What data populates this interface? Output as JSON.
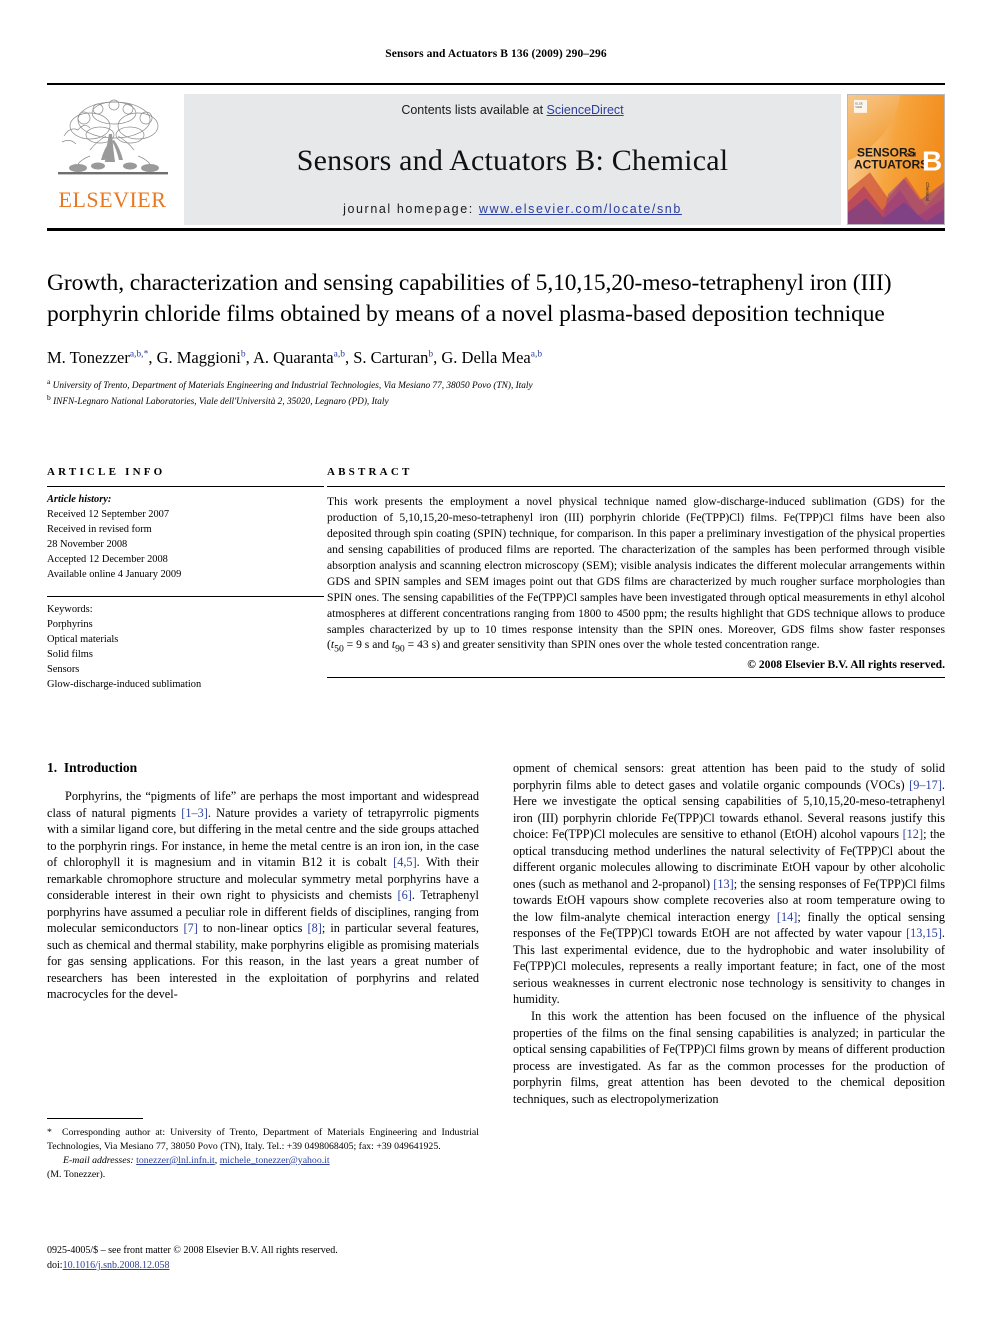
{
  "running_head": "Sensors and Actuators B 136 (2009) 290–296",
  "masthead": {
    "publisher_logo_text": "ELSEVIER",
    "contents_prefix": "Contents lists available at ",
    "contents_link": "ScienceDirect",
    "journal_title": "Sensors and Actuators B: Chemical",
    "homepage_prefix": "journal homepage: ",
    "homepage_url": "www.elsevier.com/locate/snb",
    "cover": {
      "line1": "SENSORS",
      "line1_small": "and",
      "line2": "ACTUATORS",
      "letter": "B",
      "sub": "Chemical"
    },
    "link_color": "#2b3f9e",
    "brand_color": "#E87722",
    "band_color": "#e7e8ea"
  },
  "title": "Growth, characterization and sensing capabilities of 5,10,15,20-meso-tetraphenyl iron (III) porphyrin chloride films obtained by means of a novel plasma-based deposition technique",
  "authors_html": "M. Tonezzer<sup>a,b,</sup><sup>*</sup>, G. Maggioni<sup>b</sup>, A. Quaranta<sup>a,b</sup>, S. Carturan<sup>b</sup>, G. Della Mea<sup>a,b</sup>",
  "affiliations": [
    "University of Trento, Department of Materials Engineering and Industrial Technologies, Via Mesiano 77, 38050 Povo (TN), Italy",
    "INFN-Legnaro National Laboratories, Viale dell'Università 2, 35020, Legnaro (PD), Italy"
  ],
  "affil_markers": [
    "a",
    "b"
  ],
  "article_info": {
    "heading": "ARTICLE INFO",
    "history_label": "Article history:",
    "history": [
      "Received 12 September 2007",
      "Received in revised form",
      "28 November 2008",
      "Accepted 12 December 2008",
      "Available online 4 January 2009"
    ],
    "keywords_label": "Keywords:",
    "keywords": [
      "Porphyrins",
      "Optical materials",
      "Solid films",
      "Sensors",
      "Glow-discharge-induced sublimation"
    ]
  },
  "abstract": {
    "heading": "ABSTRACT",
    "text": "This work presents the employment a novel physical technique named glow-discharge-induced sublimation (GDS) for the production of 5,10,15,20-meso-tetraphenyl iron (III) porphyrin chloride (Fe(TPP)Cl) films. Fe(TPP)Cl films have been also deposited through spin coating (SPIN) technique, for comparison. In this paper a preliminary investigation of the physical properties and sensing capabilities of produced films are reported. The characterization of the samples has been performed through visible absorption analysis and scanning electron microscopy (SEM); visible analysis indicates the different molecular arrangements within GDS and SPIN samples and SEM images point out that GDS films are characterized by much rougher surface morphologies than SPIN ones. The sensing capabilities of the Fe(TPP)Cl samples have been investigated through optical measurements in ethyl alcohol atmospheres at different concentrations ranging from 1800 to 4500 ppm; the results highlight that GDS technique allows to produce samples characterized by up to 10 times response intensity than the SPIN ones. Moreover, GDS films show faster responses (t50 = 9 s and t90 = 43 s) and greater sensitivity than SPIN ones over the whole tested concentration range.",
    "copyright": "© 2008 Elsevier B.V. All rights reserved."
  },
  "introduction": {
    "number": "1.",
    "heading": "Introduction",
    "left_paragraph_html": "Porphyrins, the “pigments of life” are perhaps the most important and widespread class of natural pigments <span class=\"ref\">[1–3]</span>. Nature provides a variety of tetrapyrrolic pigments with a similar ligand core, but differing in the metal centre and the side groups attached to the porphyrin rings. For instance, in heme the metal centre is an iron ion, in the case of chlorophyll it is magnesium and in vitamin B12 it is cobalt <span class=\"ref\">[4,5]</span>. With their remarkable chromophore structure and molecular symmetry metal porphyrins have a considerable interest in their own right to physicists and chemists <span class=\"ref\">[6]</span>. Tetraphenyl porphyrins have assumed a peculiar role in different fields of disciplines, ranging from molecular semiconductors <span class=\"ref\">[7]</span> to non-linear optics <span class=\"ref\">[8]</span>; in particular several features, such as chemical and thermal stability, make porphyrins eligible as promising materials for gas sensing applications. For this reason, in the last years a great number of researchers has been interested in the exploitation of porphyrins and related macrocycles for the devel-",
    "right_paragraph_1_html": "opment of chemical sensors: great attention has been paid to the study of solid porphyrin films able to detect gases and volatile organic compounds (VOCs) <span class=\"ref\">[9–17]</span>. Here we investigate the optical sensing capabilities of 5,10,15,20-meso-tetraphenyl iron (III) porphyrin chloride Fe(TPP)Cl towards ethanol. Several reasons justify this choice: Fe(TPP)Cl molecules are sensitive to ethanol (EtOH) alcohol vapours <span class=\"ref\">[12]</span>; the optical transducing method underlines the natural selectivity of Fe(TPP)Cl about the different organic molecules allowing to discriminate EtOH vapour by other alcoholic ones (such as methanol and 2-propanol) <span class=\"ref\">[13]</span>; the sensing responses of Fe(TPP)Cl films towards EtOH vapours show complete recoveries also at room temperature owing to the low film-analyte chemical interaction energy <span class=\"ref\">[14]</span>; finally the optical sensing responses of the Fe(TPP)Cl towards EtOH are not affected by water vapour <span class=\"ref\">[13,15]</span>. This last experimental evidence, due to the hydrophobic and water insolubility of Fe(TPP)Cl molecules, represents a really important feature; in fact, one of the most serious weaknesses in current electronic nose technology is sensitivity to changes in humidity.",
    "right_paragraph_2_html": "In this work the attention has been focused on the influence of the physical properties of the films on the final sensing capabilities is analyzed; in particular the optical sensing capabilities of Fe(TPP)Cl films grown by means of different production process are investigated. As far as the common processes for the production of porphyrin films, great attention has been devoted to the chemical deposition techniques, such as electropolymerization"
  },
  "footnote": {
    "corresponding_html": "<span class=\"star\">*</span>&nbsp; Corresponding author at: University of Trento, Department of Materials Engineering and Industrial Technologies, Via Mesiano 77, 38050 Povo (TN), Italy. Tel.: +39 0498068405; fax: +39 049641925.",
    "email_label": "E-mail addresses:",
    "email_1": "tonezzer@lnl.infn.it",
    "email_2": "michele_tonezzer@yahoo.it",
    "email_attrib": "(M. Tonezzer)."
  },
  "imprint": {
    "issn_line": "0925-4005/$ – see front matter © 2008 Elsevier B.V. All rights reserved.",
    "doi_label": "doi:",
    "doi_value": "10.1016/j.snb.2008.12.058"
  }
}
